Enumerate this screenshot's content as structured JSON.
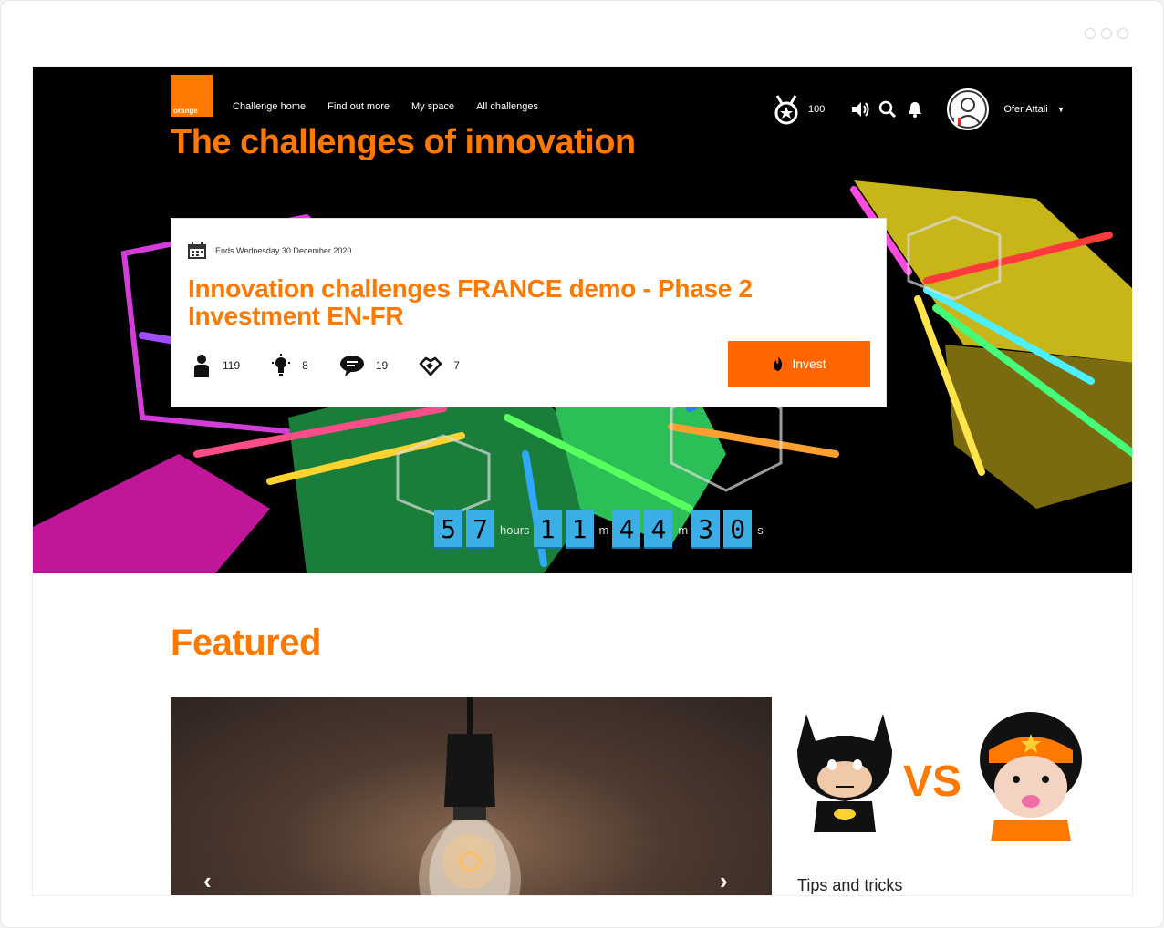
{
  "nav": {
    "logo_text": "orange",
    "links": [
      "Challenge home",
      "Find out more",
      "My space",
      "All challenges"
    ]
  },
  "user": {
    "points": "100",
    "name": "Ofer Attali"
  },
  "hero": {
    "title": "The challenges of innovation"
  },
  "challenge": {
    "end_date": "Ends Wednesday 30 December 2020",
    "title": "Innovation challenges FRANCE demo - Phase 2 Investment EN-FR",
    "stats": {
      "participants": "119",
      "ideas": "8",
      "comments": "19",
      "investments": "7"
    },
    "invest_label": "Invest"
  },
  "countdown": {
    "days": [
      "5",
      "7"
    ],
    "days_unit": "hours",
    "hours": [
      "1",
      "1"
    ],
    "hours_unit": "m",
    "minutes": [
      "4",
      "4"
    ],
    "minutes_unit": "m",
    "seconds": [
      "3",
      "0"
    ],
    "seconds_unit": "s"
  },
  "featured": {
    "title": "Featured",
    "prev": "‹",
    "next": "›"
  },
  "tips": {
    "vs_text": "VS",
    "label": "Tips and tricks"
  },
  "colors": {
    "brand": "#ff7900",
    "countdown": "#3aaee5"
  }
}
